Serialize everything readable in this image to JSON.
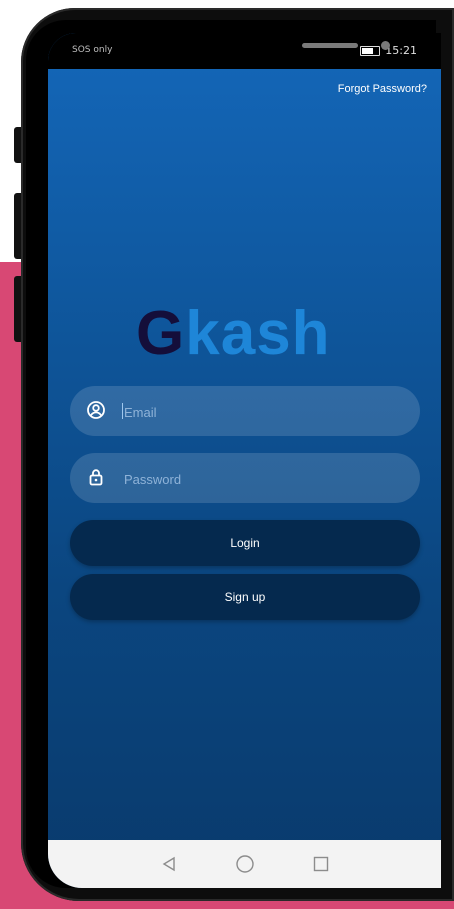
{
  "status": {
    "left_text": "SOS only",
    "time": "15:21"
  },
  "header": {
    "forgot_password": "Forgot Password?"
  },
  "logo": {
    "first": "G",
    "rest": "kash",
    "colors": {
      "g": "#140e3a",
      "kash": "#1e86d8"
    }
  },
  "form": {
    "email_placeholder": "Email",
    "password_placeholder": "Password",
    "email_icon": "user-circle-icon",
    "password_icon": "lock-icon"
  },
  "buttons": {
    "login": "Login",
    "signup": "Sign up"
  },
  "navbar": {
    "icons": [
      "back-icon",
      "home-icon",
      "recents-icon"
    ]
  },
  "colors": {
    "accent_pink": "#d84874",
    "screen_top": "#1467b9",
    "screen_bottom": "#093a6c",
    "button_bg": "#05294e"
  }
}
